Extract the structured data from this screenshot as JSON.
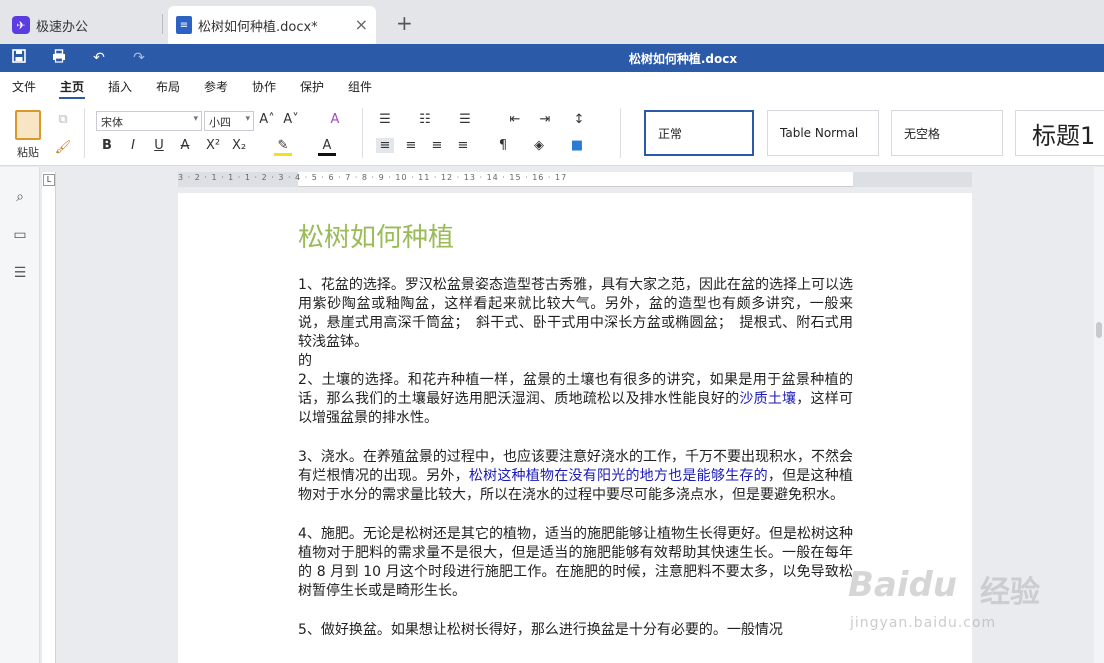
{
  "tabs": [
    {
      "label": "极速办公"
    },
    {
      "label": "松树如何种植.docx*"
    }
  ],
  "titlebar": {
    "title": "松树如何种植.docx"
  },
  "menu": [
    "文件",
    "主页",
    "插入",
    "布局",
    "参考",
    "协作",
    "保护",
    "组件"
  ],
  "ribbon": {
    "paste_label": "粘贴",
    "font_name": "宋体",
    "font_size": "小四",
    "styles": [
      "正常",
      "Table Normal",
      "无空格",
      "标题1"
    ]
  },
  "ruler": {
    "numbers": "3 · 2 · 1 · 1 · 1 · 2 · 3 · 4 · 5 · 6 · 7 · 8 · 9 · 10 · 11 · 12 · 13 · 14 · 15 · 16 · 17"
  },
  "document": {
    "title": "松树如何种植",
    "p1": "1、花盆的选择。罗汉松盆景姿态造型苍古秀雅，具有大家之范，因此在盆的选择上可以选用紫砂陶盆或釉陶盆，这样看起来就比较大气。另外，盆的造型也有颇多讲究，一般来说，悬崖式用高深千筒盆；　斜干式、卧干式用中深长方盆或椭圆盆；　提根式、附石式用较浅盆钵。",
    "p_de": "的",
    "p2a": "2、土壤的选择。和花卉种植一样，盆景的土壤也有很多的讲究，如果是用于盆景种植的话，那么我们的土壤最好选用肥沃湿润、质地疏松以及排水性能良好的",
    "p2link": "沙质土壤",
    "p2b": "，这样可以增强盆景的排水性。",
    "p3a": "3、浇水。在养殖盆景的过程中，也应该要注意好浇水的工作，千万不要出现积水，不然会有烂根情况的出现。另外，",
    "p3link": "松树这种植物在没有阳光的地方也是能够生存的",
    "p3b": "，但是这种植物对于水分的需求量比较大，所以在浇水的过程中要尽可能多浇点水，但是要避免积水。",
    "p4": "4、施肥。无论是松树还是其它的植物，适当的施肥能够让植物生长得更好。但是松树这种植物对于肥料的需求量不是很大，但是适当的施肥能够有效帮助其快速生长。一般在每年的 8 月到 10 月这个时段进行施肥工作。在施肥的时候，注意肥料不要太多，以免导致松树暂停生长或是畸形生长。",
    "p5": "5、做好换盆。如果想让松树长得好，那么进行换盆是十分有必要的。一般情况"
  },
  "watermark": {
    "brand": "Baidu",
    "cn": "经验",
    "url": "jingyan.baidu.com"
  },
  "colors": {
    "accent": "#2b5aa9",
    "title_green": "#9bbb59",
    "link_blue": "#1a1ab8"
  }
}
